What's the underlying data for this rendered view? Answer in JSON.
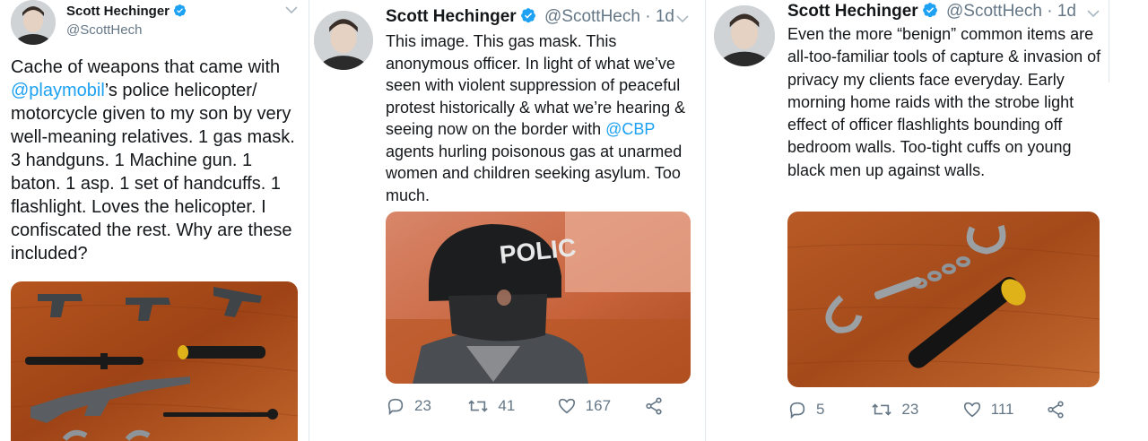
{
  "tweets": [
    {
      "author": "Scott Hechinger",
      "handle": "@ScottHech",
      "text_parts": [
        "Cache of weapons that came with ",
        "@playmobil",
        "’s police helicopter/ motorcycle given to my son by very well-meaning relatives. 1 gas mask. 3 handguns. 1 Machine gun. 1 baton. 1 asp. 1 set of handcuffs. 1 flashlight. Loves the helicopter. I confiscated the rest. Why are these included?"
      ]
    },
    {
      "author": "Scott Hechinger",
      "handle": "@ScottHech",
      "time": "· 1d",
      "text_parts": [
        "This image. This gas mask. This anonymous officer. In light of what we’ve seen with violent suppression of peaceful protest historically & what we’re hearing & seeing now on the border with ",
        "@CBP",
        " agents hurling poisonous gas at unarmed women and children seeking asylum. Too much."
      ],
      "helmet_label": "POLIC",
      "replies": "23",
      "retweets": "41",
      "likes": "167"
    },
    {
      "author": "Scott Hechinger",
      "handle": "@ScottHech",
      "time": "· 1d",
      "text": "Even the more “benign” common items are all-too-familiar tools of capture & invasion of privacy my clients face everyday. Early morning home raids with the strobe light effect of officer flashlights bounding off bedroom walls. Too-tight cuffs on young black men up against walls.",
      "replies": "5",
      "retweets": "23",
      "likes": "111"
    }
  ],
  "colors": {
    "text": "#14171a",
    "secondary": "#657786",
    "link": "#1da1f2",
    "verified": "#1da1f2",
    "divider": "#e1e8ed"
  },
  "icons": [
    "verified-badge-icon",
    "chevron-down-icon",
    "reply-icon",
    "retweet-icon",
    "like-icon",
    "share-icon"
  ]
}
